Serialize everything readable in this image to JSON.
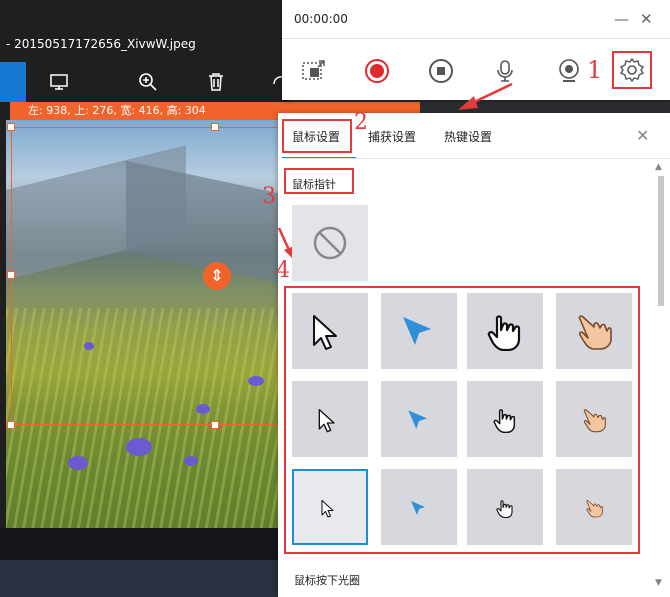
{
  "viewer": {
    "filename": "- 20150517172656_XivwW.jpeg",
    "toolbar_icons": [
      "crop-icon",
      "slideshow-icon",
      "zoom-in-icon",
      "delete-icon"
    ]
  },
  "selection": {
    "info": "左: 938, 上: 276, 宽: 416, 高: 304"
  },
  "recorder": {
    "time": "00:00:00",
    "minimize": "—",
    "close": "✕",
    "icons": [
      "region-select-icon",
      "record-icon",
      "stop-icon",
      "microphone-icon",
      "webcam-icon",
      "settings-icon"
    ]
  },
  "annotations": {
    "n1": "1",
    "n2": "2",
    "n3": "3",
    "n4": "4"
  },
  "settings": {
    "tabs": [
      "鼠标设置",
      "捕获设置",
      "热键设置"
    ],
    "active_tab": "鼠标设置",
    "close": "✕",
    "cursor_section": "鼠标指针",
    "click_section": "鼠标按下光圈",
    "cursor_options": [
      {
        "style": "white-arrow",
        "size": "large"
      },
      {
        "style": "blue-arrow",
        "size": "large"
      },
      {
        "style": "black-hand",
        "size": "large"
      },
      {
        "style": "skin-hand",
        "size": "large"
      },
      {
        "style": "white-arrow",
        "size": "medium"
      },
      {
        "style": "blue-arrow",
        "size": "medium"
      },
      {
        "style": "black-hand",
        "size": "medium"
      },
      {
        "style": "skin-hand",
        "size": "medium"
      },
      {
        "style": "white-arrow",
        "size": "small"
      },
      {
        "style": "blue-arrow",
        "size": "small"
      },
      {
        "style": "black-hand",
        "size": "small"
      },
      {
        "style": "skin-hand",
        "size": "small"
      }
    ],
    "selected_index": 8
  },
  "colors": {
    "accent": "#1f8bd5",
    "annotation_red": "#e23b3b",
    "selection_orange": "#f0642b",
    "record_red": "#e0282e"
  }
}
